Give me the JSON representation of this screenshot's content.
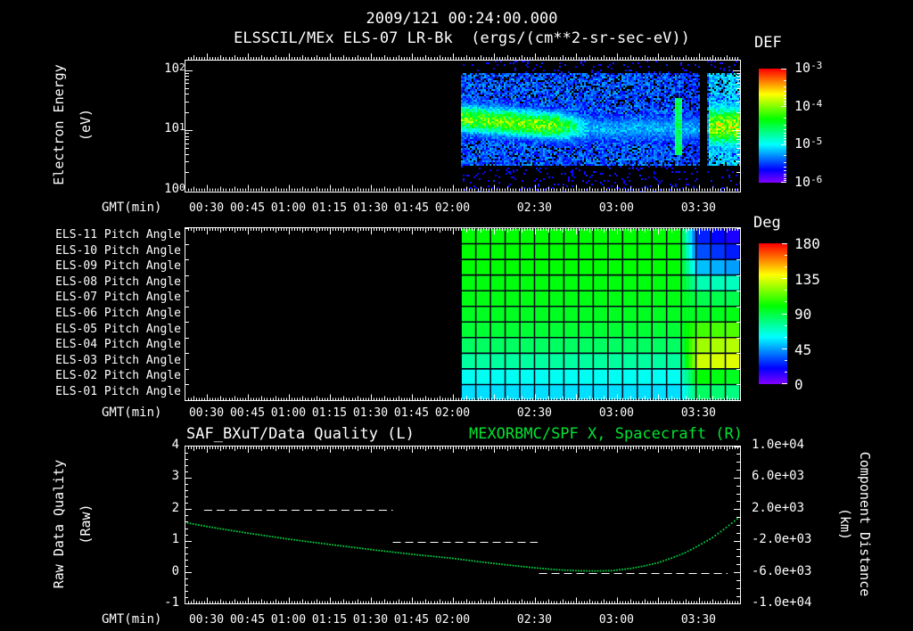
{
  "colors": {
    "background": "#000000",
    "foreground": "#ffffff",
    "title_green": "#00e432",
    "curve_green": "#00c840"
  },
  "time_axis": {
    "label": "GMT(min)",
    "range_min": [
      22,
      225.3
    ],
    "ticks": [
      {
        "min": 30,
        "label": "00:30"
      },
      {
        "min": 45,
        "label": "00:45"
      },
      {
        "min": 60,
        "label": "01:00"
      },
      {
        "min": 75,
        "label": "01:15"
      },
      {
        "min": 90,
        "label": "01:30"
      },
      {
        "min": 105,
        "label": "01:45"
      },
      {
        "min": 120,
        "label": "02:00"
      },
      {
        "min": 150,
        "label": "02:30"
      },
      {
        "min": 180,
        "label": "03:00"
      },
      {
        "min": 210,
        "label": "03:30"
      }
    ]
  },
  "chart_data": [
    {
      "type": "heatmap",
      "name": "electron-energy-spectrogram",
      "title": "2009/121 00:24:00.000",
      "subtitle": "ELSSCIL/MEx ELS-07 LR-Bk  (ergs/(cm**2-sr-sec-eV))",
      "ylabel": "Electron Energy",
      "y_unit": "(eV)",
      "y_scale": "log",
      "ylim_ev": [
        1,
        150
      ],
      "y_ticks": [
        {
          "base": "10",
          "exp": "2",
          "ev": 100
        },
        {
          "base": "10",
          "exp": "1",
          "ev": 10
        },
        {
          "base": "10",
          "exp": "0",
          "ev": 1
        }
      ],
      "colorbar": {
        "title": "DEF",
        "palette": "rainbow",
        "log10_range": [
          -6,
          -3
        ],
        "ticks": [
          {
            "base": "10",
            "exp": "-3"
          },
          {
            "base": "10",
            "exp": "-4"
          },
          {
            "base": "10",
            "exp": "-5"
          },
          {
            "base": "10",
            "exp": "-6"
          }
        ]
      },
      "features": {
        "data_start_min": 123,
        "band_center_ev_start": 16,
        "band_center_ev_end": 11,
        "band_sigma_decades": 0.17,
        "band_peak_level": 0.63,
        "band_fade_start_min": 158,
        "weak_region_min": [
          168,
          210
        ],
        "bright_stripe_min": [
          201.2,
          203.4
        ],
        "bright_stripe_ev": [
          4,
          35
        ],
        "black_gap_min": [
          210.3,
          212.8
        ],
        "end_block_min": [
          213,
          225.3
        ],
        "end_block_center_ev": 12,
        "noise_ev_range": [
          2.6,
          90
        ]
      }
    },
    {
      "type": "heatmap",
      "name": "pitch-angle-panel",
      "row_labels": [
        "ELS-11 Pitch Angle",
        "ELS-10 Pitch Angle",
        "ELS-09 Pitch Angle",
        "ELS-08 Pitch Angle",
        "ELS-07 Pitch Angle",
        "ELS-06 Pitch Angle",
        "ELS-05 Pitch Angle",
        "ELS-04 Pitch Angle",
        "ELS-03 Pitch Angle",
        "ELS-02 Pitch Angle",
        "ELS-01 Pitch Angle"
      ],
      "colorbar": {
        "title": "Deg",
        "palette": "rainbow",
        "range_deg": [
          0,
          180
        ],
        "ticks": [
          "180",
          "135",
          "90",
          "45",
          "0"
        ]
      },
      "data_start_min": 123,
      "n_cols": 19,
      "transition_col": 15,
      "values_left_deg": [
        100,
        100,
        100,
        98,
        97,
        95,
        92,
        85,
        75,
        62,
        55
      ],
      "values_right_deg": [
        25,
        32,
        50,
        72,
        88,
        95,
        110,
        125,
        132,
        100,
        85
      ],
      "values_far_right_deg": [
        16,
        24,
        45,
        70,
        88,
        97,
        112,
        128,
        135,
        95,
        80
      ]
    },
    {
      "type": "line",
      "name": "data-quality-and-distance",
      "title_left": "SAF_BXuT/Data Quality (L)",
      "title_right": "MEXORBMC/SPF X, Spacecraft (R)",
      "y_left": {
        "label": "Raw Data Quality",
        "unit": "(Raw)",
        "lim": [
          -1,
          4
        ],
        "ticks": [
          "4",
          "3",
          "2",
          "1",
          "0",
          "-1"
        ]
      },
      "y_right": {
        "label": "Component Distance",
        "unit": "(km)",
        "lim": [
          -10000,
          10000
        ],
        "ticks": [
          "1.0e+04",
          "6.0e+03",
          "2.0e+03",
          "-2.0e+03",
          "-6.0e+03",
          "-1.0e+04"
        ]
      },
      "series": [
        {
          "name": "spacecraft-x-distance",
          "axis": "right",
          "style": "dotted",
          "points": [
            [
              22,
              1.58
            ],
            [
              30,
              1.45
            ],
            [
              45,
              1.24
            ],
            [
              60,
              1.05
            ],
            [
              75,
              0.88
            ],
            [
              90,
              0.72
            ],
            [
              105,
              0.57
            ],
            [
              120,
              0.44
            ],
            [
              130,
              0.33
            ],
            [
              140,
              0.23
            ],
            [
              150,
              0.14
            ],
            [
              158,
              0.08
            ],
            [
              165,
              0.05
            ],
            [
              172,
              0.04
            ],
            [
              178,
              0.05
            ],
            [
              185,
              0.12
            ],
            [
              190,
              0.2
            ],
            [
              195,
              0.3
            ],
            [
              200,
              0.45
            ],
            [
              205,
              0.62
            ],
            [
              210,
              0.85
            ],
            [
              215,
              1.1
            ],
            [
              220,
              1.42
            ],
            [
              225.3,
              1.78
            ]
          ]
        },
        {
          "name": "raw-data-quality",
          "axis": "left",
          "style": "dashed",
          "segments": [
            {
              "value": 2,
              "t_start": 29,
              "t_end": 98
            },
            {
              "value": 1,
              "t_start": 98,
              "t_end": 151
            },
            {
              "value": 0,
              "t_start": 151.5,
              "t_end": 220.5
            }
          ]
        }
      ]
    }
  ]
}
